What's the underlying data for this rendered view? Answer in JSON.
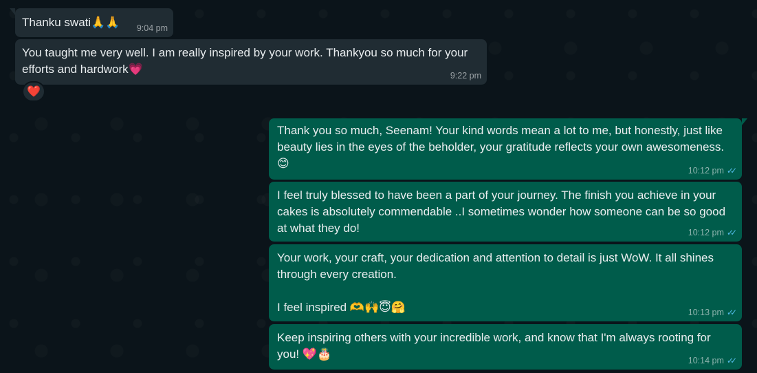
{
  "colors": {
    "background": "#0b141a",
    "incoming_bubble": "#202c33",
    "outgoing_bubble": "#005c4b",
    "read_ticks": "#53bdeb",
    "reaction_heart": "#e8323d"
  },
  "messages": [
    {
      "direction": "incoming",
      "text": "Thanku swati🙏🙏",
      "time": "9:04 pm"
    },
    {
      "direction": "incoming",
      "text": "You taught me very well. I am really inspired by your work. Thankyou so much for your efforts and hardwork💗",
      "time": "9:22 pm",
      "reaction": "❤️"
    },
    {
      "direction": "outgoing",
      "text": "Thank you so much, Seenam! Your kind words mean a lot to me, but honestly, just like beauty lies in the eyes of the beholder, your gratitude reflects your own awesomeness. 😊",
      "time": "10:12 pm",
      "status": "read"
    },
    {
      "direction": "outgoing",
      "text": "I feel truly blessed to have been a part of your journey. The finish you achieve in your cakes is absolutely commendable ..I sometimes wonder how someone can be so good at what they do!",
      "time": "10:12 pm",
      "status": "read"
    },
    {
      "direction": "outgoing",
      "text": "Your work, your craft, your dedication and attention to detail is just WoW. It all shines through every creation.\n\nI feel inspired 🫶🙌😇🤗",
      "time": "10:13 pm",
      "status": "read"
    },
    {
      "direction": "outgoing",
      "text": "Keep inspiring others with your incredible work, and know that I'm always rooting for you! 💖🎂",
      "time": "10:14 pm",
      "status": "read"
    }
  ],
  "icons": {
    "read_status": "double-check-icon"
  }
}
